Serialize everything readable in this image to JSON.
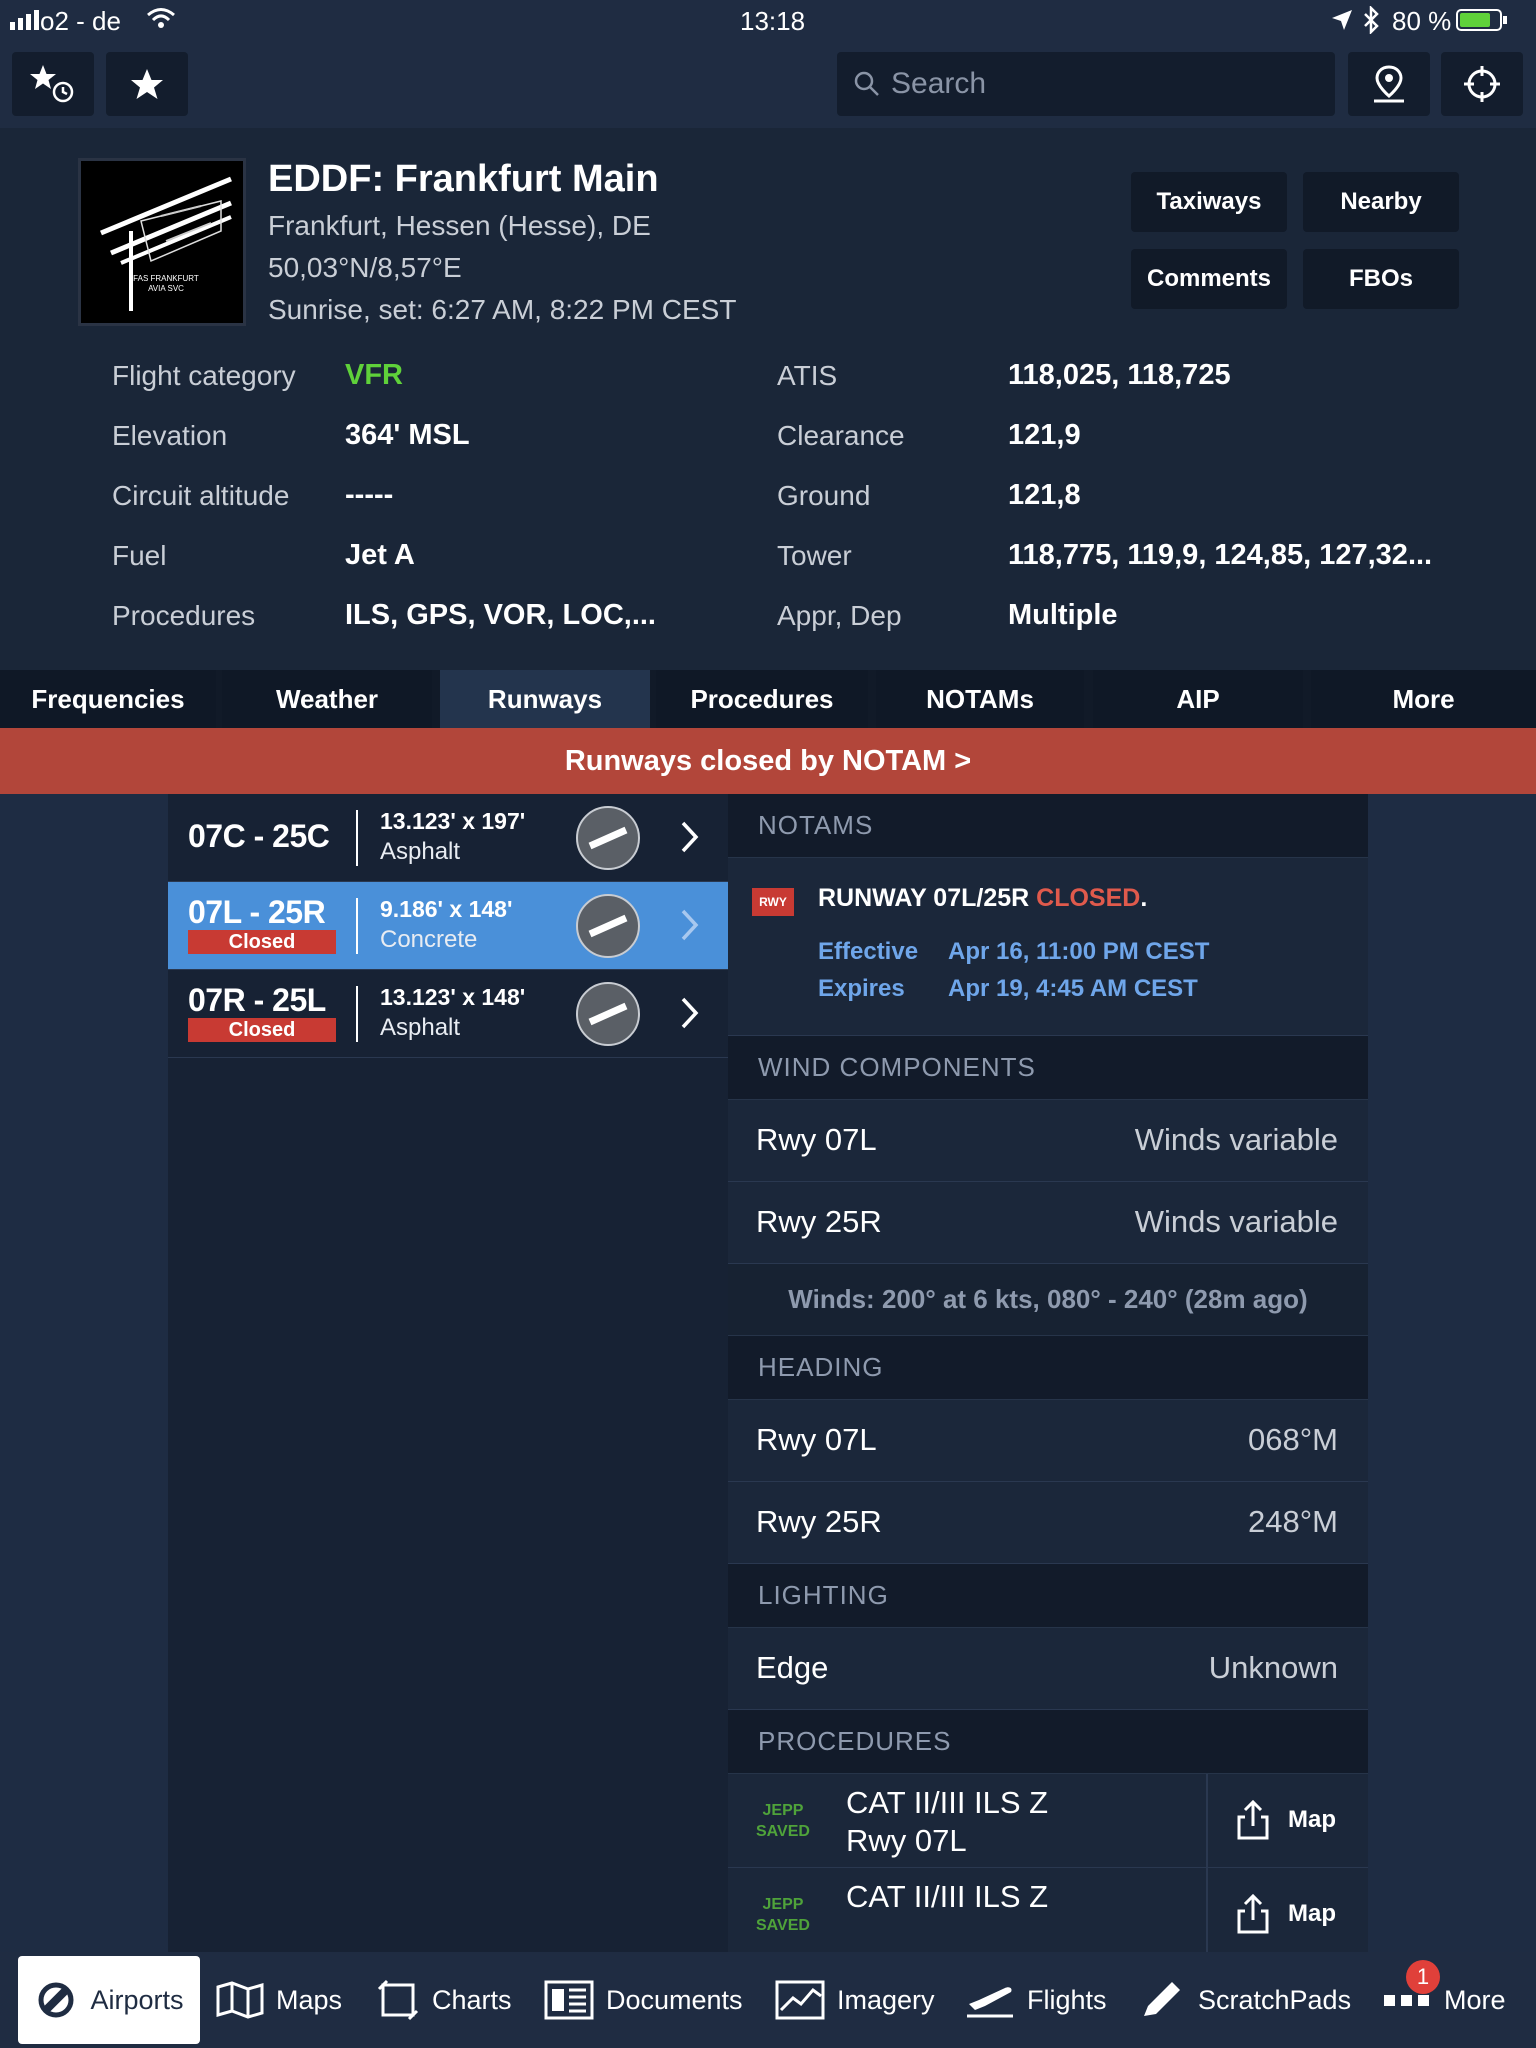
{
  "status_bar": {
    "carrier": "o2 - de",
    "time": "13:18",
    "battery": "80 %"
  },
  "topbar": {
    "search_placeholder": "Search"
  },
  "airport": {
    "title": "EDDF: Frankfurt Main",
    "location": "Frankfurt, Hessen (Hesse), DE",
    "coords": "50,03°N/8,57°E",
    "sun": "Sunrise, set: 6:27 AM, 8:22 PM CEST",
    "diagram_caption": "FAS FRANKFURT AVIA SVC",
    "buttons": [
      "Taxiways",
      "Nearby",
      "Comments",
      "FBOs"
    ]
  },
  "info_left": [
    {
      "label": "Flight category",
      "value": "VFR"
    },
    {
      "label": "Elevation",
      "value": "364' MSL"
    },
    {
      "label": "Circuit altitude",
      "value": "-----"
    },
    {
      "label": "Fuel",
      "value": "Jet A"
    },
    {
      "label": "Procedures",
      "value": "ILS, GPS, VOR, LOC,..."
    }
  ],
  "info_right": [
    {
      "label": "ATIS",
      "value": "118,025, 118,725"
    },
    {
      "label": "Clearance",
      "value": "121,9"
    },
    {
      "label": "Ground",
      "value": "121,8"
    },
    {
      "label": "Tower",
      "value": "118,775, 119,9, 124,85, 127,32..."
    },
    {
      "label": "Appr, Dep",
      "value": "Multiple"
    }
  ],
  "tabs": [
    "Frequencies",
    "Weather",
    "Runways",
    "Procedures",
    "NOTAMs",
    "AIP",
    "More"
  ],
  "active_tab": "Runways",
  "banner": "Runways closed by NOTAM >",
  "runways": [
    {
      "name": "07C - 25C",
      "dims": "13.123' x 197'",
      "surface": "Asphalt",
      "closed": ""
    },
    {
      "name": "07L - 25R",
      "dims": "9.186' x 148'",
      "surface": "Concrete",
      "closed": "Closed"
    },
    {
      "name": "07R - 25L",
      "dims": "13.123' x 148'",
      "surface": "Asphalt",
      "closed": "Closed"
    }
  ],
  "notams": {
    "header": "NOTAMS",
    "badge": "RWY",
    "text": "RUNWAY 07L/25R",
    "closed_word": "CLOSED",
    "period": ".",
    "effective_label": "Effective",
    "effective": "Apr 16, 11:00 PM CEST",
    "expires_label": "Expires",
    "expires": "Apr 19, 4:45 AM CEST"
  },
  "wind": {
    "header": "WIND COMPONENTS",
    "rows": [
      {
        "label": "Rwy 07L",
        "value": "Winds variable"
      },
      {
        "label": "Rwy 25R",
        "value": "Winds variable"
      }
    ],
    "summary": "Winds: 200° at 6 kts, 080° - 240° (28m ago)"
  },
  "heading": {
    "header": "HEADING",
    "rows": [
      {
        "label": "Rwy 07L",
        "value": "068°M"
      },
      {
        "label": "Rwy 25R",
        "value": "248°M"
      }
    ]
  },
  "lighting": {
    "header": "LIGHTING",
    "rows": [
      {
        "label": "Edge",
        "value": "Unknown"
      }
    ]
  },
  "procedures": {
    "header": "PROCEDURES",
    "rows": [
      {
        "badge1": "JEPP",
        "badge2": "SAVED",
        "line1": "CAT II/III ILS Z",
        "line2": "Rwy 07L",
        "action": "Map"
      },
      {
        "badge1": "JEPP",
        "badge2": "SAVED",
        "line1": "CAT II/III ILS Z",
        "line2": "",
        "action": "Map"
      }
    ]
  },
  "bottom_nav": [
    "Airports",
    "Maps",
    "Charts",
    "Documents",
    "Imagery",
    "Flights",
    "ScratchPads",
    "More"
  ],
  "more_badge": "1",
  "colors": {
    "vfr": "#5fd13a",
    "closed": "#c83a33",
    "banner": "#b2463a",
    "selected": "#4a90d9"
  }
}
